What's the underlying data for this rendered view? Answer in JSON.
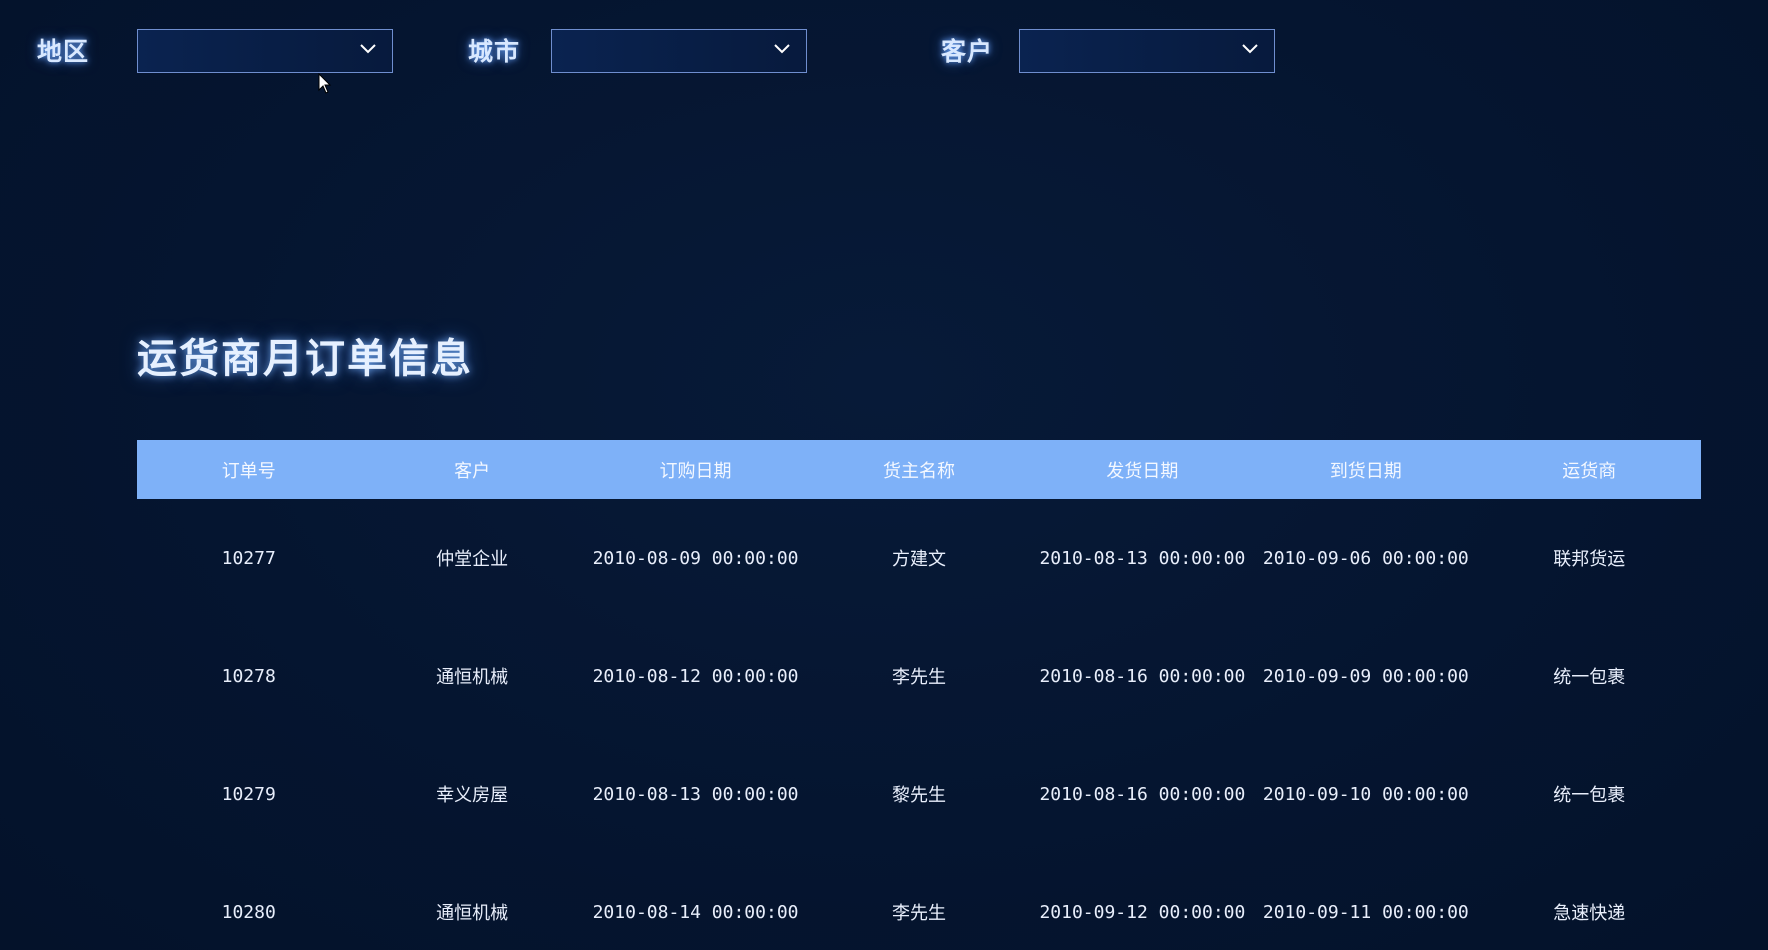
{
  "filters": [
    {
      "label": "地区",
      "value": ""
    },
    {
      "label": "城市",
      "value": ""
    },
    {
      "label": "客户",
      "value": ""
    }
  ],
  "title": "运货商月订单信息",
  "table": {
    "headers": [
      "订单号",
      "客户",
      "订购日期",
      "货主名称",
      "发货日期",
      "到货日期",
      "运货商"
    ],
    "rows": [
      [
        "10277",
        "仲堂企业",
        "2010-08-09 00:00:00",
        "方建文",
        "2010-08-13 00:00:00",
        "2010-09-06 00:00:00",
        "联邦货运"
      ],
      [
        "10278",
        "通恒机械",
        "2010-08-12 00:00:00",
        "李先生",
        "2010-08-16 00:00:00",
        "2010-09-09 00:00:00",
        "统一包裹"
      ],
      [
        "10279",
        "幸义房屋",
        "2010-08-13 00:00:00",
        "黎先生",
        "2010-08-16 00:00:00",
        "2010-09-10 00:00:00",
        "统一包裹"
      ],
      [
        "10280",
        "通恒机械",
        "2010-08-14 00:00:00",
        "李先生",
        "2010-09-12 00:00:00",
        "2010-09-11 00:00:00",
        "急速快递"
      ]
    ]
  },
  "colors": {
    "background": "#051530",
    "header_bg": "#7eb1f8",
    "select_border": "#6f8ecf"
  },
  "icons": {
    "dropdown": "chevron-down-icon",
    "pointer": "mouse-cursor-icon"
  }
}
